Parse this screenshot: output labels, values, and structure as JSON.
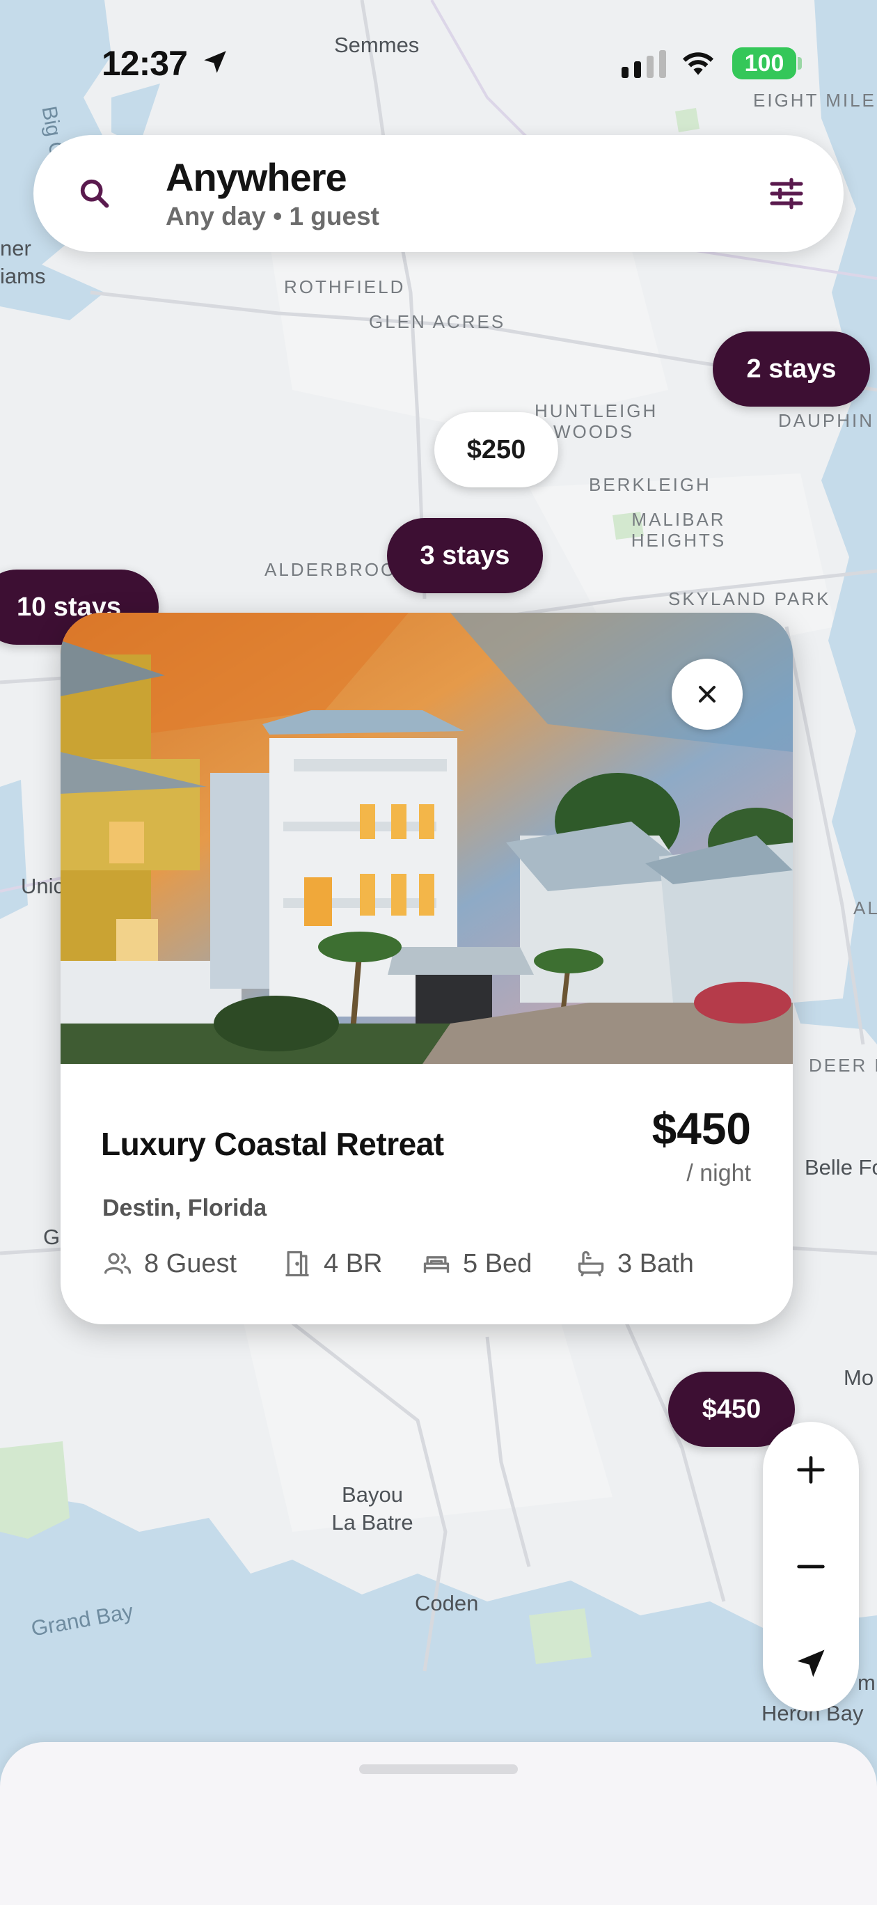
{
  "status_bar": {
    "time": "12:37",
    "battery": "100"
  },
  "search": {
    "title": "Anywhere",
    "subtitle": "Any day • 1 guest"
  },
  "map_labels": {
    "semmes": "Semmes",
    "eight_mile": "EIGHT MILE",
    "rothfield": "ROTHFIELD",
    "glen_acres": "GLEN ACRES",
    "huntleigh_woods_1": "HUNTLEIGH",
    "huntleigh_woods_2": "WOODS",
    "dauphin": "DAUPHIN A",
    "berkleigh": "BERKLEIGH",
    "malibar_1": "MALIBAR",
    "malibar_2": "HEIGHTS",
    "alderbrook": "ALDERBROOK",
    "skyland_park": "SKYLAND PARK",
    "big_c": "Big C",
    "ner": "ner",
    "iams": "iams",
    "unic": "Unic",
    "al": "AL",
    "deer": "DEER R",
    "belle": "Belle Fo",
    "g": "G",
    "mo": "Mo",
    "bayou_1": "Bayou",
    "bayou_2": "La Batre",
    "coden": "Coden",
    "grand_bay": "Grand Bay",
    "heron_bay": "Heron Bay",
    "m": "m"
  },
  "pins": {
    "two_stays": "2 stays",
    "price_250": "$250",
    "three_stays": "3 stays",
    "ten_stays": "10 stays",
    "price_450": "$450"
  },
  "listing": {
    "title": "Luxury Coastal Retreat",
    "price": "$450",
    "per": "/ night",
    "location": "Destin, Florida",
    "guests": "8 Guest",
    "bedrooms": "4 BR",
    "beds": "5 Bed",
    "baths": "3 Bath"
  },
  "colors": {
    "pin_dark": "#3d0f33",
    "accent": "#5a1a4e",
    "battery": "#34c759"
  }
}
